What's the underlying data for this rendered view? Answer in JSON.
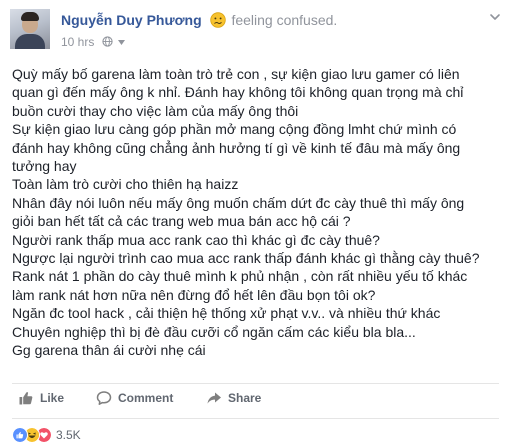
{
  "post": {
    "author_name": "Nguyễn Duy Phương",
    "feeling_text": "feeling confused.",
    "feeling_icon": "confused-face-icon",
    "timestamp": "10 hrs",
    "privacy_icon": "globe-icon",
    "body_lines": [
      "Quỳ mấy bố garena làm toàn trò trẻ con , sự kiện giao lưu gamer có liên",
      "quan gì đến mấy ông k nhỉ. Đánh hay không tôi không quan trọng mà chỉ",
      "buồn cười thay cho việc làm của mấy ông thôi",
      "Sự kiện giao lưu càng góp phần mở mang cộng đồng lmht chứ mình có",
      "đánh hay không cũng chẳng ảnh hưởng tí gì về kinh tế đâu mà mấy ông",
      "tưởng hay",
      "Toàn làm trò cười cho thiên hạ haizz",
      "Nhân đây nói luôn nếu mấy ông muốn chấm dứt đc cày thuê thì mấy ông",
      "giỏi ban hết tất cả các trang web mua bán acc hộ cái ?",
      "Người rank thấp mua acc rank cao thì khác gì đc cày thuê?",
      "Ngược lại người trình cao mua acc rank thấp đánh khác gì thằng cày thuê?",
      "Rank nát 1 phần do cày thuê mình k phủ nhận , còn rất nhiều yếu tố khác",
      "làm rank nát hơn nữa nên đừng đổ hết lên đầu bọn tôi ok?",
      "Ngăn đc tool hack , cải thiện hệ thống xử phạt v.v.. và nhiều thứ khác",
      "Chuyên nghiệp thì bị đè đầu cưỡi cổ ngăn cấm các kiểu bla bla...",
      "Gg garena thân ái cười nhẹ cái"
    ]
  },
  "actions": {
    "like_label": "Like",
    "comment_label": "Comment",
    "share_label": "Share"
  },
  "reactions": {
    "icons": [
      "like-reaction-icon",
      "haha-reaction-icon",
      "love-reaction-icon"
    ],
    "count": "3.5K"
  },
  "colors": {
    "author": "#365899",
    "meta": "#90949c",
    "like_blue": "#5890ff",
    "haha_yellow": "#f7c22e",
    "love_red": "#f25268"
  }
}
